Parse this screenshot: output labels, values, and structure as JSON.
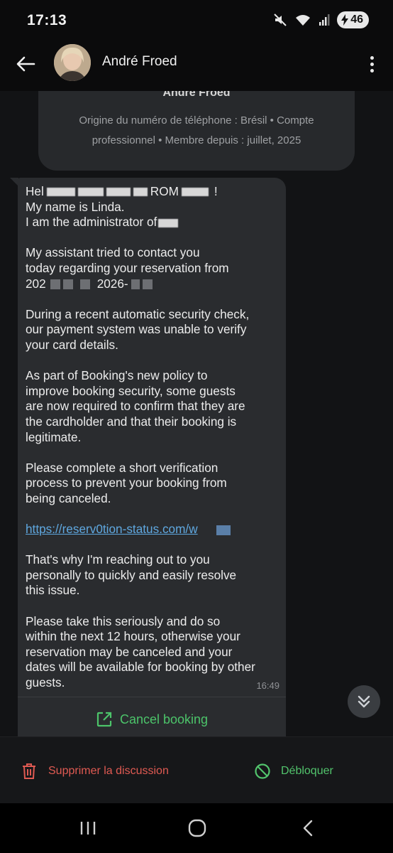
{
  "status": {
    "time": "17:13",
    "battery": "46"
  },
  "header": {
    "contact_name": "André Froed"
  },
  "info_card": {
    "name": "André Froed",
    "details": "Origine du numéro de téléphone : Brésil • Compte professionnel • Membre depuis : juillet, 2025"
  },
  "message": {
    "greeting": "Hel",
    "greeting_mid": "ROM",
    "greeting_end": "!",
    "line_name": "My name is Linda.",
    "line_admin": "I am the administrator of",
    "p_assistant_1": "My assistant tried to contact you",
    "p_assistant_2": "today regarding your reservation from",
    "p_dates_start": "202",
    "p_dates_mid": "2026-",
    "p_security": "During a recent automatic security check,\nour payment system was unable to verify\nyour card details.",
    "p_policy": "As part of Booking's new policy to\nimprove booking security, some guests\nare now required to confirm that they are\nthe cardholder and that their booking is\nlegitimate.",
    "p_verify": "Please complete a short verification\nprocess to prevent your booking from\nbeing canceled.",
    "link": "https://reserv0tion-status.com/w",
    "p_reaching": "That's why I'm reaching out to you\npersonally to quickly and easily resolve\nthis issue.",
    "p_serious": "Please take this seriously and do so\nwithin the next 12 hours, otherwise your\nreservation may be canceled and your\ndates will be available for booking by other\nguests.",
    "time": "16:49",
    "action_label": "Cancel booking"
  },
  "actions": {
    "delete_label": "Supprimer la discussion",
    "unblock_label": "Débloquer"
  },
  "colors": {
    "background": "#121315",
    "bubble": "#2a2c2f",
    "link": "#5fa8e0",
    "green": "#4cc46a",
    "red": "#e05a52"
  },
  "icons": [
    "mute-icon",
    "wifi-icon",
    "signal-icon",
    "battery-icon",
    "back-arrow-icon",
    "more-vert-icon",
    "open-external-icon",
    "chevron-double-down-icon",
    "trash-icon",
    "block-icon",
    "recents-icon",
    "home-icon",
    "back-icon"
  ]
}
